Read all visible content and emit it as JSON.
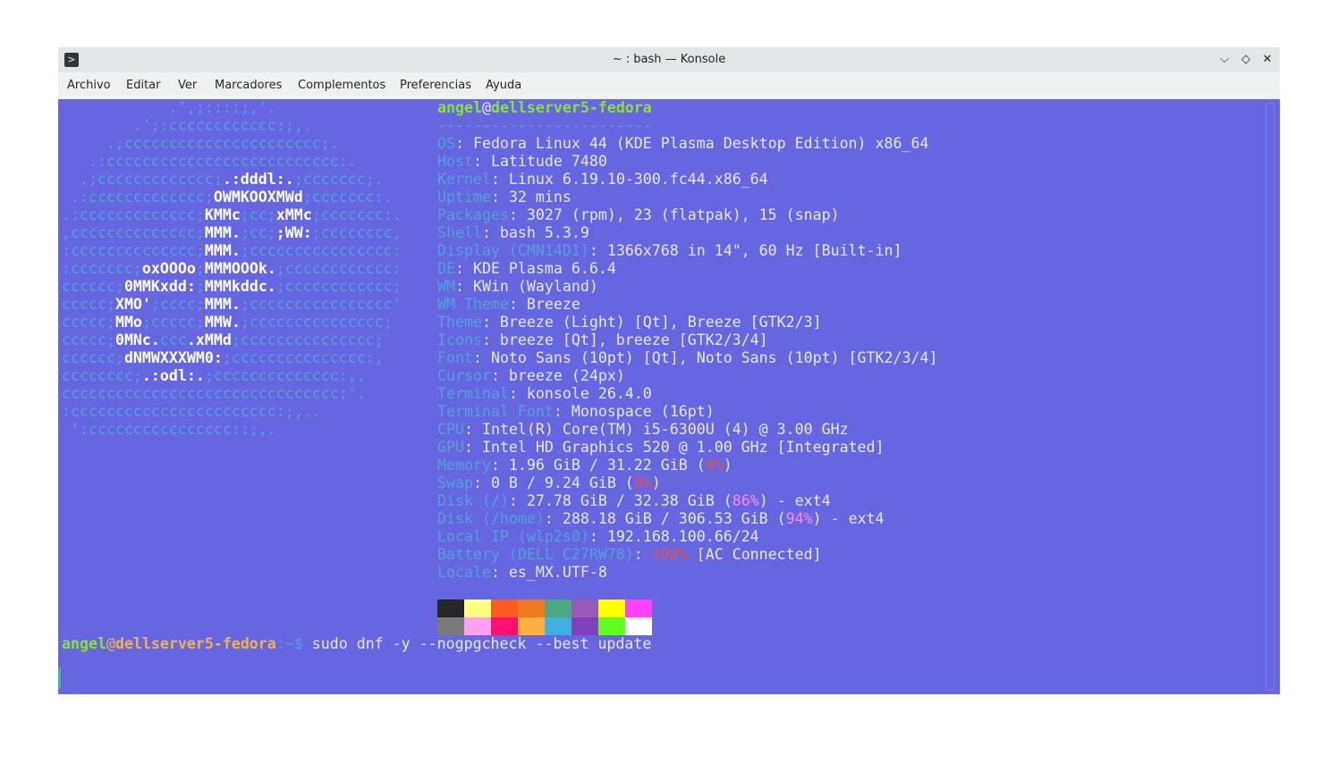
{
  "window": {
    "title": "~ : bash — Konsole",
    "controls": [
      "⌵",
      "◇",
      "✕"
    ]
  },
  "menu": [
    "Archivo",
    "Editar",
    "Ver",
    "Marcadores",
    "Complementos",
    "Preferencias",
    "Ayuda"
  ],
  "art": [
    [
      {
        "t": "            .',;::::;,'."
      }
    ],
    [
      {
        "t": "        .';:cccccccccccc:;,."
      }
    ],
    [
      {
        "t": "     .;cccccccccccccccccccccc;."
      }
    ],
    [
      {
        "t": "   .:cccccccccccccccccccccccccc:."
      }
    ],
    [
      {
        "t": "  .;ccccccccccccc;"
      },
      {
        "t": ".:dddl:.",
        "b": true
      },
      {
        "t": ";ccccccc;."
      }
    ],
    [
      {
        "t": " .:ccccccccccccc;"
      },
      {
        "t": "OWMKOOXMWd",
        "b": true
      },
      {
        "t": ";ccccccc:."
      }
    ],
    [
      {
        "t": ".:ccccccccccccc;"
      },
      {
        "t": "KMMc",
        "b": true
      },
      {
        "t": ";cc;"
      },
      {
        "t": "xMMc",
        "b": true
      },
      {
        "t": ";ccccccc:."
      }
    ],
    [
      {
        "t": ",cccccccccccccc;"
      },
      {
        "t": "MMM.",
        "b": true
      },
      {
        "t": ";cc;"
      },
      {
        "t": ";WW:",
        "b": true
      },
      {
        "t": ";cccccccc,"
      }
    ],
    [
      {
        "t": ":cccccccccccccc;"
      },
      {
        "t": "MMM.",
        "b": true
      },
      {
        "t": ";cccccccccccccccc:"
      }
    ],
    [
      {
        "t": ":ccccccc;"
      },
      {
        "t": "oxOOOo",
        "b": true
      },
      {
        "t": ";"
      },
      {
        "t": "MMMOOOk.",
        "b": true
      },
      {
        "t": ";cccccccccccc:"
      }
    ],
    [
      {
        "t": "cccccc;"
      },
      {
        "t": "0MMKxdd:",
        "b": true
      },
      {
        "t": ";"
      },
      {
        "t": "MMMkddc.",
        "b": true
      },
      {
        "t": ";cccccccccccc;"
      }
    ],
    [
      {
        "t": "ccccc;"
      },
      {
        "t": "XMO'",
        "b": true
      },
      {
        "t": ";cccc;"
      },
      {
        "t": "MMM.",
        "b": true
      },
      {
        "t": ";cccccccccccccccc'"
      }
    ],
    [
      {
        "t": "ccccc;"
      },
      {
        "t": "MMo",
        "b": true
      },
      {
        "t": ";ccccc;"
      },
      {
        "t": "MMW.",
        "b": true
      },
      {
        "t": ";ccccccccccccccc;"
      }
    ],
    [
      {
        "t": "ccccc;"
      },
      {
        "t": "0MNc.",
        "b": true
      },
      {
        "t": "ccc"
      },
      {
        "t": ".xMMd",
        "b": true
      },
      {
        "t": ";ccccccccccccccc;"
      }
    ],
    [
      {
        "t": "cccccc;"
      },
      {
        "t": "dNMWXXXWM0:",
        "b": true
      },
      {
        "t": ";ccccccccccccccc:,"
      }
    ],
    [
      {
        "t": "cccccccc;"
      },
      {
        "t": ".:odl:.",
        "b": true
      },
      {
        "t": ";cccccccccccccc:,."
      }
    ],
    [
      {
        "t": "ccccccccccccccccccccccccccccccc:'."
      }
    ],
    [
      {
        "t": ":ccccccccccccccccccccccc:;,.."
      }
    ],
    [
      {
        "t": " ':cccccccccccccccc::;,."
      }
    ]
  ],
  "header": {
    "user": "angel",
    "at": "@",
    "host": "dellserver5-fedora",
    "separator": "------------------------"
  },
  "info": [
    [
      {
        "t": "OS",
        "c": "k"
      },
      {
        "t": ": Fedora Linux 44 (KDE Plasma Desktop Edition) x86_64"
      }
    ],
    [
      {
        "t": "Host",
        "c": "k"
      },
      {
        "t": ": Latitude 7480"
      }
    ],
    [
      {
        "t": "Kernel",
        "c": "k"
      },
      {
        "t": ": Linux 6.19.10-300.fc44.x86_64"
      }
    ],
    [
      {
        "t": "Uptime",
        "c": "k"
      },
      {
        "t": ": 32 mins"
      }
    ],
    [
      {
        "t": "Packages",
        "c": "k"
      },
      {
        "t": ": 3027 (rpm), 23 (flatpak), 15 (snap)"
      }
    ],
    [
      {
        "t": "Shell",
        "c": "k"
      },
      {
        "t": ": bash 5.3.9"
      }
    ],
    [
      {
        "t": "Display (CMN14D1)",
        "c": "k"
      },
      {
        "t": ": 1366x768 in 14\", 60 Hz [Built-in]"
      }
    ],
    [
      {
        "t": "DE",
        "c": "k"
      },
      {
        "t": ": KDE Plasma 6.6.4"
      }
    ],
    [
      {
        "t": "WM",
        "c": "k"
      },
      {
        "t": ": KWin (Wayland)"
      }
    ],
    [
      {
        "t": "WM Theme",
        "c": "k"
      },
      {
        "t": ": Breeze"
      }
    ],
    [
      {
        "t": "Theme",
        "c": "k"
      },
      {
        "t": ": Breeze (Light) [Qt], Breeze [GTK2/3]"
      }
    ],
    [
      {
        "t": "Icons",
        "c": "k"
      },
      {
        "t": ": breeze [Qt], breeze [GTK2/3/4]"
      }
    ],
    [
      {
        "t": "Font",
        "c": "k"
      },
      {
        "t": ": Noto Sans (10pt) [Qt], Noto Sans (10pt) [GTK2/3/4]"
      }
    ],
    [
      {
        "t": "Cursor",
        "c": "k"
      },
      {
        "t": ": breeze (24px)"
      }
    ],
    [
      {
        "t": "Terminal",
        "c": "k"
      },
      {
        "t": ": konsole 26.4.0"
      }
    ],
    [
      {
        "t": "Terminal Font",
        "c": "k"
      },
      {
        "t": ": Monospace (16pt)"
      }
    ],
    [
      {
        "t": "CPU",
        "c": "k"
      },
      {
        "t": ": Intel(R) Core(TM) i5-6300U (4) @ 3.00 GHz"
      }
    ],
    [
      {
        "t": "GPU",
        "c": "k"
      },
      {
        "t": ": Intel HD Graphics 520 @ 1.00 GHz [Integrated]"
      }
    ],
    [
      {
        "t": "Memory",
        "c": "k"
      },
      {
        "t": ": 1.96 GiB / 31.22 GiB ("
      },
      {
        "t": "6%",
        "c": "pct-red"
      },
      {
        "t": ")"
      }
    ],
    [
      {
        "t": "Swap",
        "c": "k"
      },
      {
        "t": ": 0 B / 9.24 GiB ("
      },
      {
        "t": "0%",
        "c": "pct-red"
      },
      {
        "t": ")"
      }
    ],
    [
      {
        "t": "Disk (/)",
        "c": "k"
      },
      {
        "t": ": 27.78 GiB / 32.38 GiB ("
      },
      {
        "t": "86%",
        "c": "pct-pink"
      },
      {
        "t": ") - ext4"
      }
    ],
    [
      {
        "t": "Disk (/home)",
        "c": "k"
      },
      {
        "t": ": 288.18 GiB / 306.53 GiB ("
      },
      {
        "t": "94%",
        "c": "pct-pink"
      },
      {
        "t": ") - ext4"
      }
    ],
    [
      {
        "t": "Local IP (wlp2s0)",
        "c": "k"
      },
      {
        "t": ": 192.168.100.66/24"
      }
    ],
    [
      {
        "t": "Battery (DELL C27RW78)",
        "c": "k"
      },
      {
        "t": ": "
      },
      {
        "t": "100%",
        "c": "pct-red"
      },
      {
        "t": " [AC Connected]"
      }
    ],
    [
      {
        "t": "Locale",
        "c": "k"
      },
      {
        "t": ": es_MX.UTF-8"
      }
    ]
  ],
  "palette": {
    "top": [
      "#262626",
      "#ffff80",
      "#ff5a1f",
      "#f07820",
      "#4aa882",
      "#9a58b8",
      "#ffff00",
      "#ff40ff"
    ],
    "bottom": [
      "#7a7a7a",
      "#ffa0f0",
      "#ff1070",
      "#ffb040",
      "#40b0e0",
      "#8040c0",
      "#60ff20",
      "#ffffff"
    ]
  },
  "prompt": {
    "user": "angel",
    "at": "@",
    "host": "dellserver5-fedora",
    "path": ":~$ ",
    "command": "sudo dnf -y --nogpgcheck --best update"
  }
}
